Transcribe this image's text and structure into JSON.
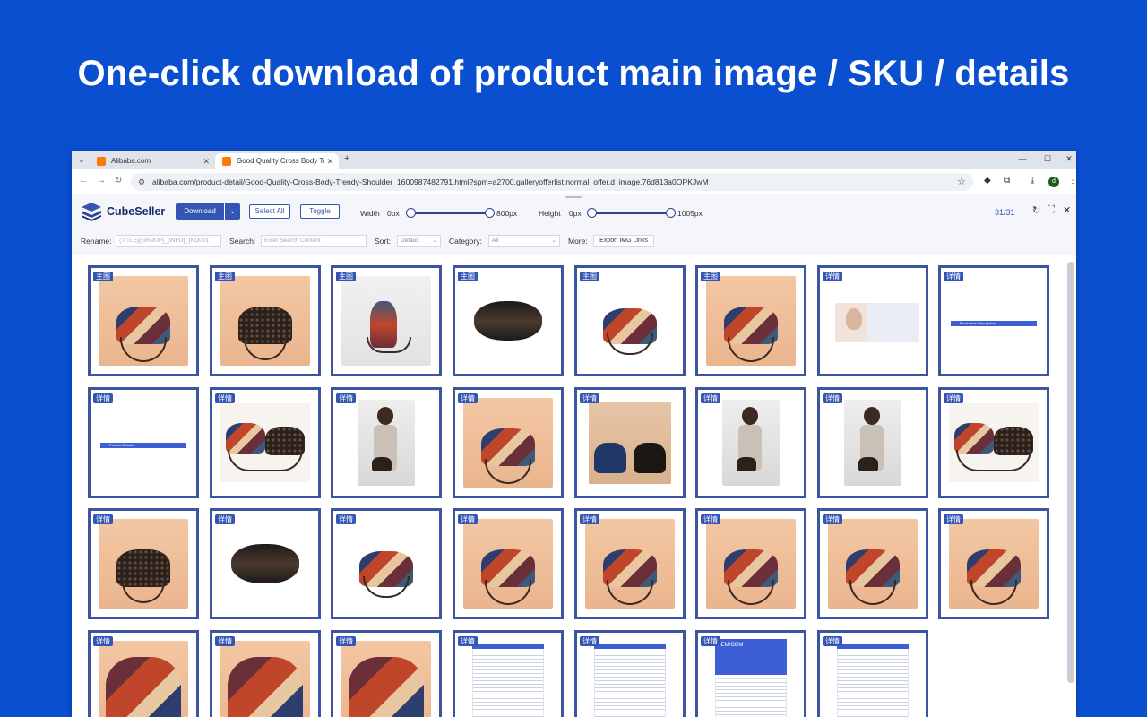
{
  "headline": "One-click download of product main image / SKU / details",
  "browser": {
    "tabs": [
      {
        "title": "Alibaba.com"
      },
      {
        "title": "Good Quality Cross Body Tre"
      }
    ],
    "url": "alibaba.com/product-detail/Good-Quality-Cross-Body-Trendy-Shoulder_1600987482791.html?spm=a2700.galleryofferlist.normal_offer.d_image.76d813a0OPKJwM",
    "avatar_letter": "d"
  },
  "plugin": {
    "brand": "CubeSeller",
    "download_label": "Download",
    "select_all_label": "Select All",
    "toggle_label": "Toggle",
    "width_label": "Width",
    "width_min": "0px",
    "width_max": "800px",
    "height_label": "Height",
    "height_min": "0px",
    "height_max": "1005px",
    "counter": "31/31",
    "rename_label": "Rename:",
    "rename_value": "{TITLE}{GROUP}_{INFO}_{NO001",
    "search_label": "Search:",
    "search_placeholder": "Enter Search Content",
    "sort_label": "Sort:",
    "sort_value": "Default",
    "category_label": "Category:",
    "category_value": "All",
    "more_label": "More:",
    "export_label": "Export IMG Links",
    "accent": "#3455b3"
  },
  "images": [
    {
      "tag": "主图",
      "kind": "patch"
    },
    {
      "tag": "主图",
      "kind": "mono"
    },
    {
      "tag": "主图",
      "kind": "side"
    },
    {
      "tag": "主图",
      "kind": "open"
    },
    {
      "tag": "主图",
      "kind": "patch-white"
    },
    {
      "tag": "主图",
      "kind": "patch"
    },
    {
      "tag": "详情",
      "kind": "model-doc"
    },
    {
      "tag": "详情",
      "kind": "banner",
      "caption": "Productive Description"
    },
    {
      "tag": "详情",
      "kind": "banner",
      "caption": "Product Details"
    },
    {
      "tag": "详情",
      "kind": "pair"
    },
    {
      "tag": "详情",
      "kind": "person"
    },
    {
      "tag": "详情",
      "kind": "patch"
    },
    {
      "tag": "详情",
      "kind": "pair-hang"
    },
    {
      "tag": "详情",
      "kind": "person"
    },
    {
      "tag": "详情",
      "kind": "person"
    },
    {
      "tag": "详情",
      "kind": "pair"
    },
    {
      "tag": "详情",
      "kind": "mono"
    },
    {
      "tag": "详情",
      "kind": "open"
    },
    {
      "tag": "详情",
      "kind": "patch-white"
    },
    {
      "tag": "详情",
      "kind": "patch"
    },
    {
      "tag": "详情",
      "kind": "patch"
    },
    {
      "tag": "详情",
      "kind": "patch"
    },
    {
      "tag": "详情",
      "kind": "patch"
    },
    {
      "tag": "详情",
      "kind": "patch"
    },
    {
      "tag": "详情",
      "kind": "closeup"
    },
    {
      "tag": "详情",
      "kind": "closeup"
    },
    {
      "tag": "详情",
      "kind": "closeup"
    },
    {
      "tag": "详情",
      "kind": "doc"
    },
    {
      "tag": "详情",
      "kind": "doc"
    },
    {
      "tag": "详情",
      "kind": "oem",
      "caption": "OEM/ODM"
    },
    {
      "tag": "详情",
      "kind": "doc"
    }
  ]
}
